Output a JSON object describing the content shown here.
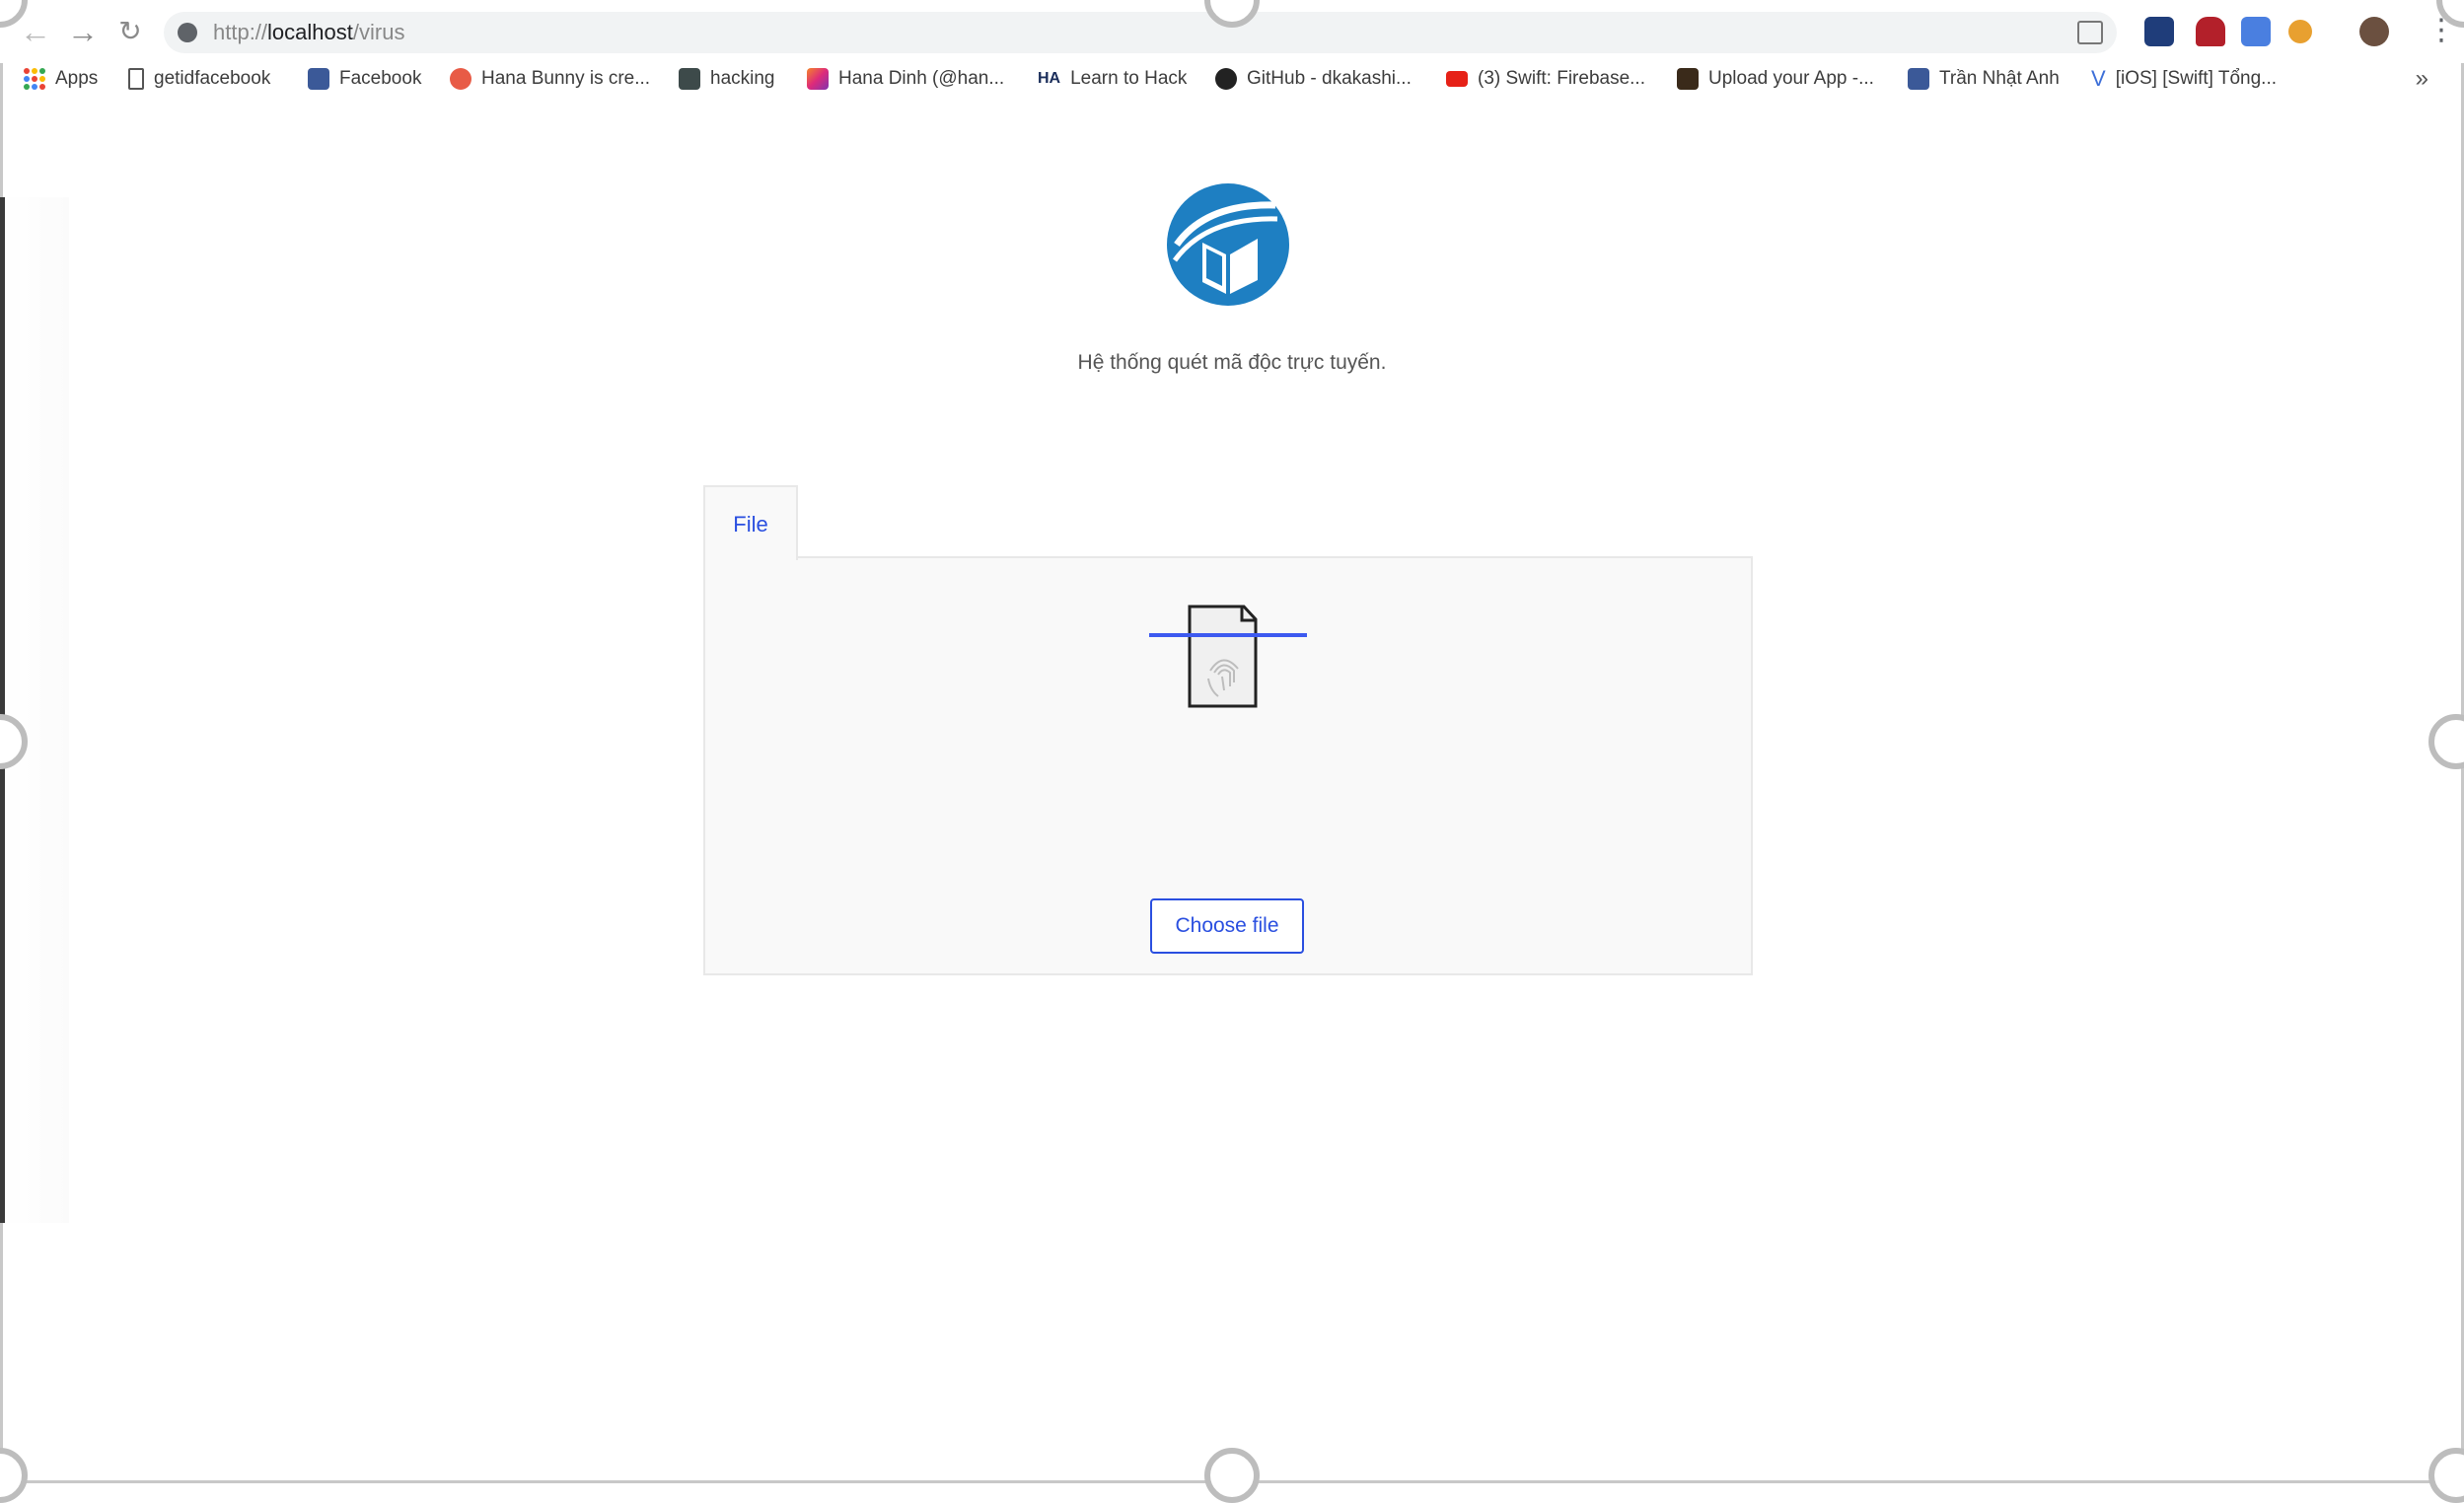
{
  "browser": {
    "url_scheme": "http://",
    "url_host": "localhost",
    "url_path": "/virus"
  },
  "bookmarks": [
    {
      "label": "Apps",
      "icon": "apps-grid-icon"
    },
    {
      "label": "getidfacebook",
      "icon": "page-icon"
    },
    {
      "label": "Facebook",
      "icon": "facebook-icon"
    },
    {
      "label": "Hana Bunny is cre...",
      "icon": "patreon-icon"
    },
    {
      "label": "hacking",
      "icon": "terminal-icon"
    },
    {
      "label": "Hana Dinh (@han...",
      "icon": "instagram-icon"
    },
    {
      "label": "Learn to Hack",
      "icon": "ha-icon"
    },
    {
      "label": "GitHub - dkakashi...",
      "icon": "github-icon"
    },
    {
      "label": "(3) Swift: Firebase...",
      "icon": "youtube-icon"
    },
    {
      "label": "Upload your App -...",
      "icon": "diawi-icon"
    },
    {
      "label": "Trần Nhật Anh",
      "icon": "facebook-icon"
    },
    {
      "label": "[iOS] [Swift] Tổng...",
      "icon": "viblo-icon"
    }
  ],
  "bookmarks_more": "»",
  "page": {
    "tagline": "Hệ thống quét mã độc trực tuyến.",
    "tab_label": "File",
    "choose_button": "Choose file"
  },
  "colors": {
    "accent": "#2a4fe0",
    "logo": "#1e7fc2",
    "panel_bg": "#f9f9f9"
  }
}
